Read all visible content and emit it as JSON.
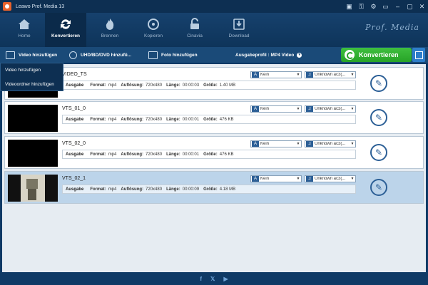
{
  "window": {
    "title": "Leawo Prof. Media 13"
  },
  "modules": [
    {
      "label": "Home",
      "icon": "home-icon",
      "active": false
    },
    {
      "label": "Konvertieren",
      "icon": "convert-icon",
      "active": true
    },
    {
      "label": "Brennen",
      "icon": "burn-icon",
      "active": false
    },
    {
      "label": "Kopieren",
      "icon": "copy-icon",
      "active": false
    },
    {
      "label": "Cinavia",
      "icon": "cinavia-icon",
      "active": false
    },
    {
      "label": "Download",
      "icon": "download-icon",
      "active": false
    }
  ],
  "brand": "Prof. Media",
  "actions": {
    "add_video": "Video hinzufügen",
    "add_disc": "UHD/BD/DVD hinzufü...",
    "add_photo": "Foto hinzufügen"
  },
  "profile": {
    "label": "Ausgabeprofil :",
    "value": "MP4 Video"
  },
  "convert_label": "Konvertieren",
  "dropdown": [
    "Video hinzufügen",
    "Videoordner hinzufügen"
  ],
  "info_labels": {
    "output": "Ausgabe",
    "format": "Format:",
    "resolution": "Auflösung:",
    "length": "Länge:",
    "size": "Größe:"
  },
  "files": [
    {
      "name": "VIDEO_TS",
      "subtitle": "Kein",
      "audio": "Unknown ac3(...",
      "format": "mp4",
      "resolution": "720x480",
      "length": "00:00:03",
      "size": "1.40 MB",
      "selected": false
    },
    {
      "name": "VTS_01_0",
      "subtitle": "Kein",
      "audio": "Unknown ac3(...",
      "format": "mp4",
      "resolution": "720x480",
      "length": "00:00:01",
      "size": "476 KB",
      "selected": false
    },
    {
      "name": "VTS_02_0",
      "subtitle": "Kein",
      "audio": "Unknown ac3(...",
      "format": "mp4",
      "resolution": "720x480",
      "length": "00:00:01",
      "size": "476 KB",
      "selected": false
    },
    {
      "name": "VTS_02_1",
      "subtitle": "Kein",
      "audio": "Unknown ac3(...",
      "format": "mp4",
      "resolution": "720x480",
      "length": "00:00:09",
      "size": "4.18 MB",
      "selected": true
    }
  ],
  "colors": {
    "accent_green": "#27a327",
    "nav_dark": "#0d2f52",
    "selected_row": "#bcd4ea"
  }
}
